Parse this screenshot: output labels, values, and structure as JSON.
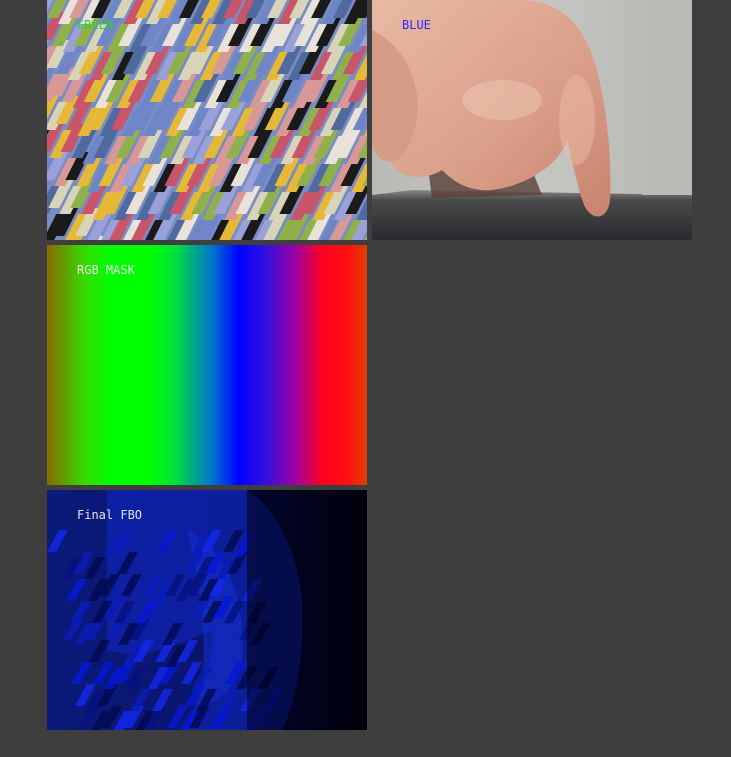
{
  "panels": {
    "green": {
      "label": "GREEN",
      "label_color": "#2bd42b"
    },
    "blue": {
      "label": "BLUE",
      "label_color": "#2a2aff"
    },
    "mask": {
      "label": "RGB MASK",
      "label_color": "#e6e6e6"
    },
    "final": {
      "label": "Final FBO",
      "label_color": "#e6e6e6"
    }
  },
  "colors": {
    "background": "#3e3e3e",
    "stripe_palette": [
      "#6e86c8",
      "#d8d4b8",
      "#c8556a",
      "#8fb04a",
      "#e6b838",
      "#1a1a1a",
      "#9aa0d8",
      "#e8e2d8",
      "#506aa0",
      "#d89898"
    ]
  }
}
